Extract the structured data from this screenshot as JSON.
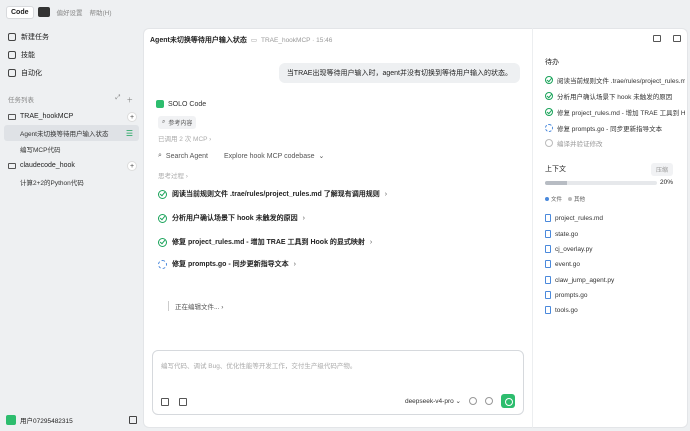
{
  "sidebar": {
    "mode_code": "Code",
    "menu": [
      "偏好设置",
      "帮助(H)"
    ],
    "nav": [
      {
        "label": "新建任务",
        "icon": "new-task-icon"
      },
      {
        "label": "技能",
        "icon": "skills-icon"
      },
      {
        "label": "自动化",
        "icon": "automation-icon"
      }
    ],
    "section_title": "任务列表",
    "groups": [
      {
        "name": "TRAE_hookMCP",
        "tasks": [
          "Agent未切换等待用户输入状态",
          "编写MCP代码"
        ]
      },
      {
        "name": "claudecode_hook",
        "tasks": [
          "计算2+2的Python代码"
        ]
      }
    ],
    "user": "用户07295482315"
  },
  "main": {
    "title": "Agent未切换等待用户输入状态",
    "project": "TRAE_hookMCP · 15:46",
    "user_message": "当TRAE出现等待用户输入时，agent并没有切换到等待用户输入的状态。",
    "solo_label": "SOLO Code",
    "reference_chip": "参考内容",
    "mcp_count": "已调用 2 次 MCP",
    "search_agent": "Search Agent",
    "search_task": "Explore hook MCP codebase",
    "thinking": "思考过程",
    "steps": [
      {
        "label": "阅读当前规则文件 .trae/rules/project_rules.md 了解现有调用规则",
        "status": "done"
      },
      {
        "label": "分析用户确认场景下 hook 未触发的原因",
        "status": "done"
      },
      {
        "label": "修复 project_rules.md - 增加 TRAE 工具到 Hook 的显式映射",
        "status": "done"
      },
      {
        "label": "修复 prompts.go - 同步更新指导文本",
        "status": "running"
      }
    ],
    "editing": "正在编辑文件...",
    "composer_placeholder": "编写代码、调试 Bug、优化性能等开发工作，交付生产级代码产物。",
    "model": "deepseek-v4-pro"
  },
  "right": {
    "todo_title": "待办",
    "todos": [
      {
        "label": "阅读当前规则文件 .trae/rules/project_rules.md",
        "status": "done"
      },
      {
        "label": "分析用户确认场景下 hook 未触发的原因",
        "status": "done"
      },
      {
        "label": "修复 project_rules.md - 增加 TRAE 工具到 Hook",
        "status": "done"
      },
      {
        "label": "修复 prompts.go - 同步更新指导文本",
        "status": "running"
      },
      {
        "label": "编译并验证修改",
        "status": "pending"
      }
    ],
    "context_title": "上下文",
    "context_button": "压缩",
    "context_percent": "20%",
    "context_fraction": 0.2,
    "tabs": [
      "文件",
      "其他"
    ],
    "files": [
      "project_rules.md",
      "state.go",
      "cj_overlay.py",
      "event.go",
      "claw_jump_agent.py",
      "prompts.go",
      "tools.go"
    ]
  }
}
